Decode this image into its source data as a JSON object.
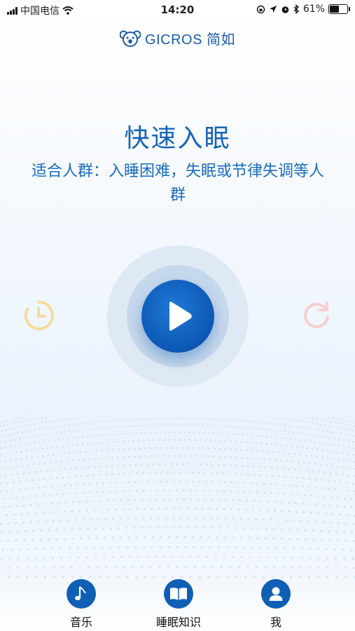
{
  "status_bar": {
    "carrier": "中国电信",
    "time": "14:20",
    "battery": "61%",
    "battery_level": 0.61,
    "icons": [
      "signal-icon",
      "wifi-icon",
      "orientation-lock-icon",
      "location-icon",
      "alarm-icon",
      "bluetooth-icon",
      "battery-icon"
    ]
  },
  "header": {
    "logo_text": "GICROS 简如"
  },
  "main": {
    "title": "快速入眠",
    "subtitle": "适合人群：入睡困难，失眠或节律失调等人群",
    "timer_icon": "clock-icon",
    "play_icon": "play-icon",
    "replay_icon": "replay-icon"
  },
  "tabbar": {
    "items": [
      {
        "label": "音乐",
        "icon": "music-note-icon"
      },
      {
        "label": "睡眠知识",
        "icon": "book-icon"
      },
      {
        "label": "我",
        "icon": "user-icon"
      }
    ]
  },
  "colors": {
    "brand": "#1565b5",
    "tab_icon_bg": "#0f5fb5",
    "timer_icon": "#f3dc9c",
    "replay_icon": "#f5cfcf"
  }
}
